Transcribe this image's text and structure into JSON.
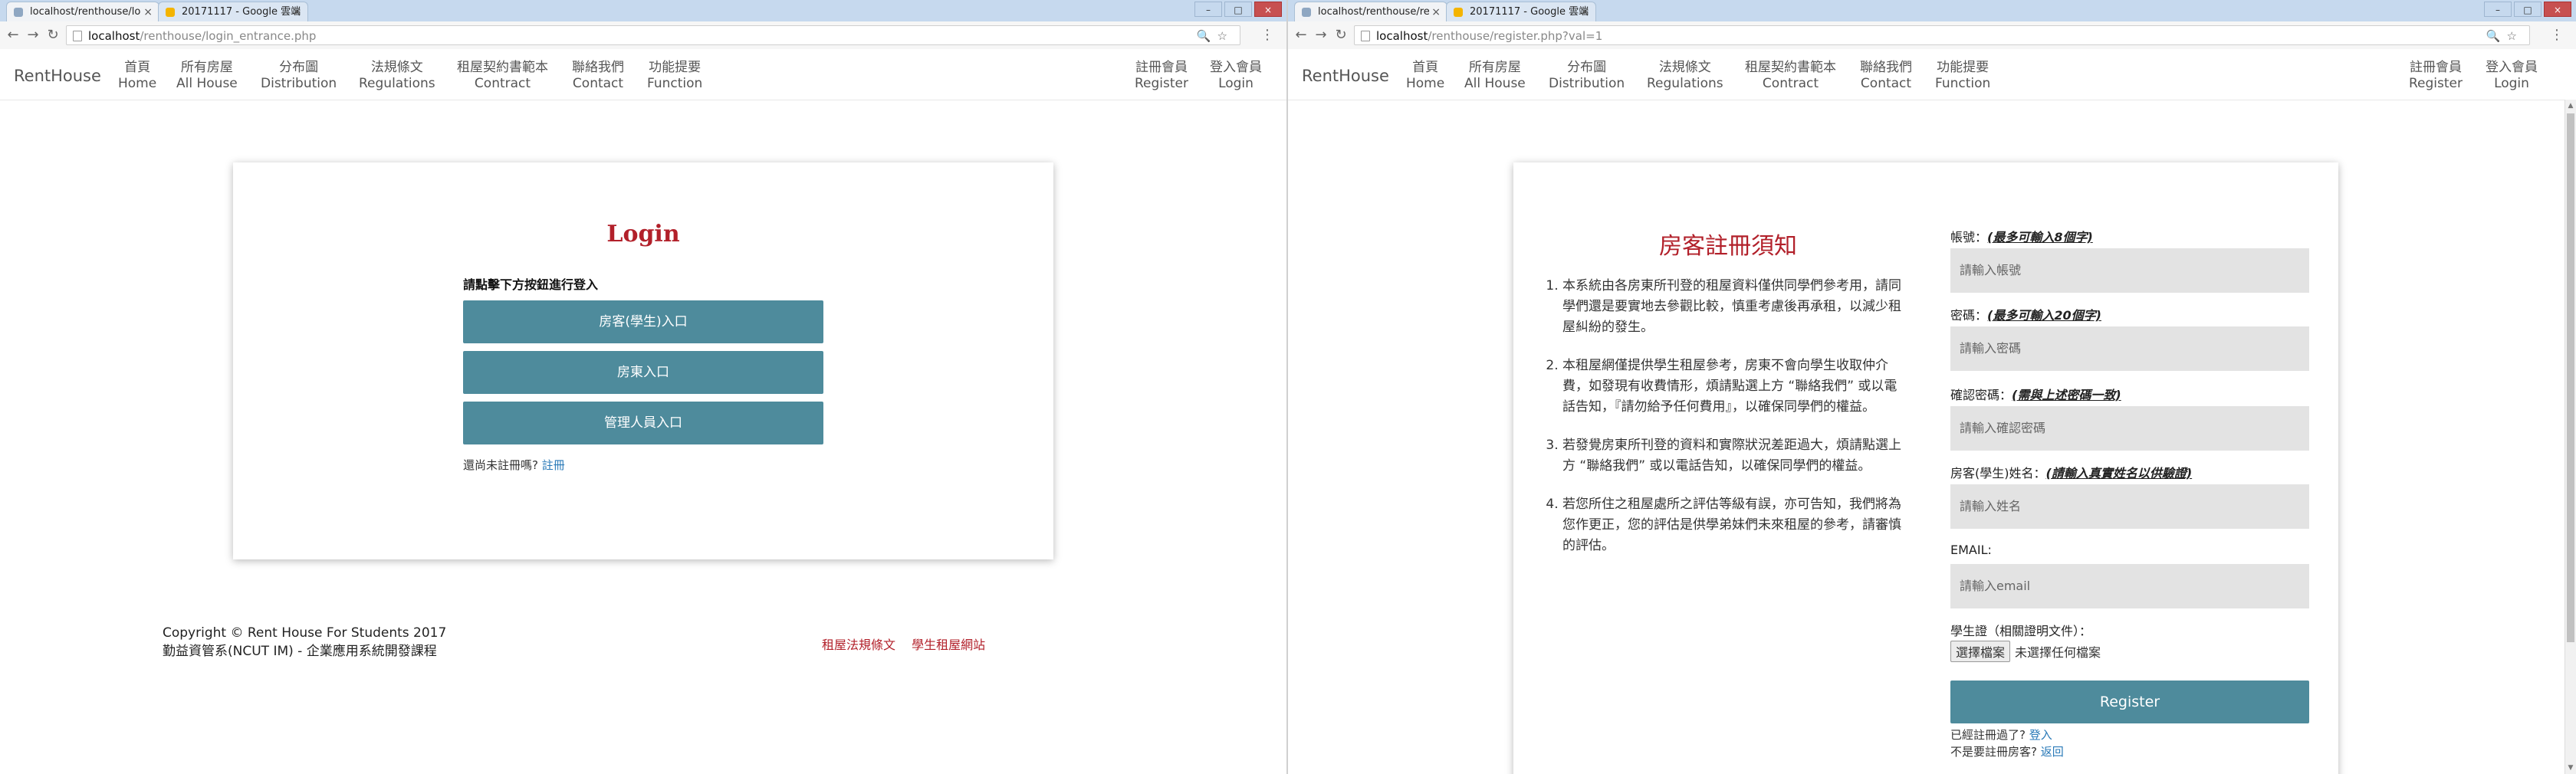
{
  "left": {
    "tabs": [
      {
        "label": "localhost/renthouse/lo",
        "active": true
      },
      {
        "label": "20171117 - Google 雲端",
        "active": false
      }
    ],
    "address": {
      "host": "localhost",
      "path": "/renthouse/login_entrance.php"
    },
    "navbar": {
      "brand": "RentHouse",
      "items": [
        {
          "zh": "首頁",
          "en": "Home"
        },
        {
          "zh": "所有房屋",
          "en": "All House"
        },
        {
          "zh": "分布圖",
          "en": "Distribution"
        },
        {
          "zh": "法規條文",
          "en": "Regulations"
        },
        {
          "zh": "租屋契約書範本",
          "en": "Contract"
        },
        {
          "zh": "聯絡我們",
          "en": "Contact"
        },
        {
          "zh": "功能提要",
          "en": "Function"
        }
      ],
      "right_items": [
        {
          "zh": "註冊會員",
          "en": "Register"
        },
        {
          "zh": "登入會員",
          "en": "Login"
        }
      ]
    },
    "login": {
      "title": "Login",
      "prompt": "請點擊下方按鈕進行登入",
      "buttons": [
        "房客(學生)入口",
        "房東入口",
        "管理人員入口"
      ],
      "no_account_text": "還尚未註冊嗎?",
      "register_link": "註冊"
    },
    "footer": {
      "copyright": "Copyright © Rent House For Students 2017",
      "dept": "勤益資管系(NCUT IM) - 企業應用系統開發課程",
      "links": [
        "租屋法規條文",
        "學生租屋網站"
      ]
    }
  },
  "right": {
    "tabs": [
      {
        "label": "localhost/renthouse/re",
        "active": true
      },
      {
        "label": "20171117 - Google 雲端",
        "active": false
      }
    ],
    "address": {
      "host": "localhost",
      "path": "/renthouse/register.php?val=1"
    },
    "navbar": {
      "brand": "RentHouse",
      "items": [
        {
          "zh": "首頁",
          "en": "Home"
        },
        {
          "zh": "所有房屋",
          "en": "All House"
        },
        {
          "zh": "分布圖",
          "en": "Distribution"
        },
        {
          "zh": "法規條文",
          "en": "Regulations"
        },
        {
          "zh": "租屋契約書範本",
          "en": "Contract"
        },
        {
          "zh": "聯絡我們",
          "en": "Contact"
        },
        {
          "zh": "功能提要",
          "en": "Function"
        }
      ],
      "right_items": [
        {
          "zh": "註冊會員",
          "en": "Register"
        },
        {
          "zh": "登入會員",
          "en": "Login"
        }
      ]
    },
    "notice": {
      "title": "房客註冊須知",
      "items": [
        "本系統由各房東所刊登的租屋資料僅供同學們參考用，請同學們還是要實地去參觀比較，慎重考慮後再承租，以減少租屋糾紛的發生。",
        "本租屋網僅提供學生租屋參考，房東不會向學生收取仲介費，如發現有收費情形，煩請點選上方 “聯絡我們” 或以電話告知，『請勿給予任何費用』，以確保同學們的權益。",
        "若發覺房東所刊登的資料和實際狀況差距過大，煩請點選上方 “聯絡我們” 或以電話告知，以確保同學們的權益。",
        "若您所住之租屋處所之評估等級有誤，亦可告知，我們將為您作更正，您的評估是供學弟妹們未來租屋的參考，請審慎的評估。"
      ]
    },
    "form": {
      "account_label": "帳號：",
      "account_hint": "(最多可輸入8個字)",
      "account_placeholder": "請輸入帳號",
      "password_label": "密碼：",
      "password_hint": "(最多可輸入20個字)",
      "password_placeholder": "請輸入密碼",
      "confirm_label": "確認密碼：",
      "confirm_hint": "(需與上述密碼一致)",
      "confirm_placeholder": "請輸入確認密碼",
      "name_label": "房客(學生)姓名：",
      "name_hint": "(請輸入真實姓名以供驗證)",
      "name_placeholder": "請輸入姓名",
      "email_label": "EMAIL:",
      "email_placeholder": "請輸入email",
      "student_id_label": "學生證（相關證明文件）：",
      "choose_file": "選擇檔案",
      "no_file": "未選擇任何檔案",
      "register_button": "Register",
      "already_registered": "已經註冊過了?",
      "login_link": "登入",
      "not_tenant": "不是要註冊房客?",
      "back_link": "返回"
    }
  }
}
